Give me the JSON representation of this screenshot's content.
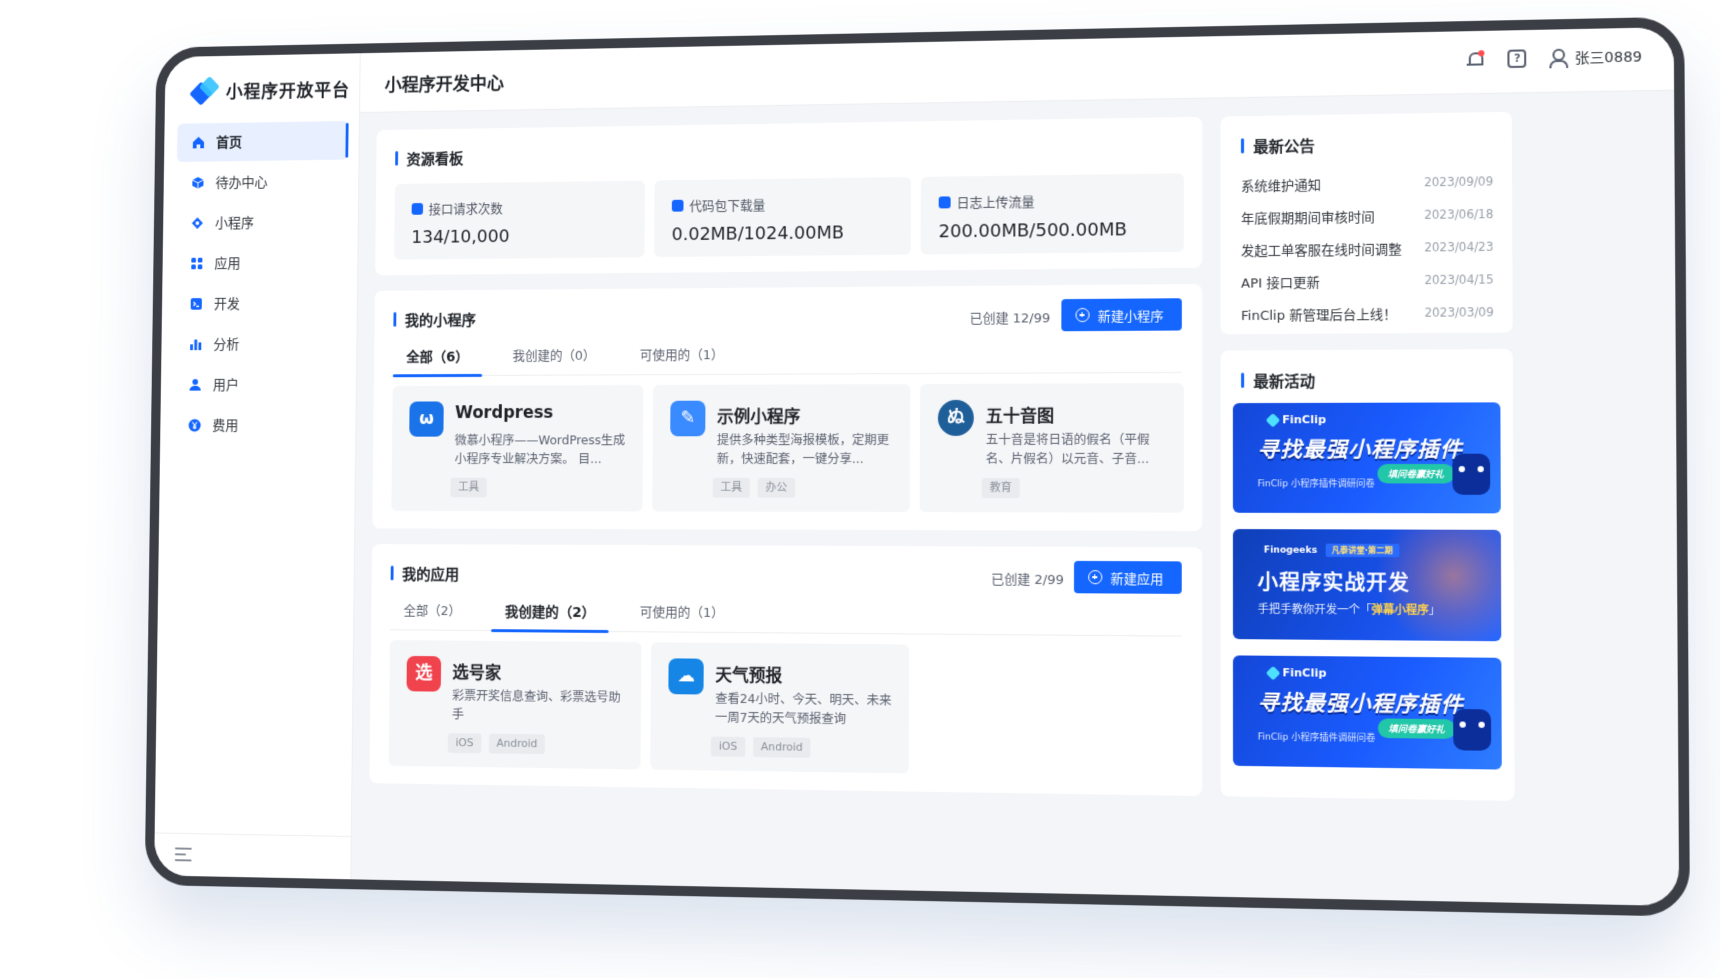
{
  "sidebar": {
    "logo_text": "小程序开放平台",
    "items": [
      {
        "label": "首页",
        "icon": "home-icon"
      },
      {
        "label": "待办中心",
        "icon": "cube-icon"
      },
      {
        "label": "小程序",
        "icon": "diamond-icon"
      },
      {
        "label": "应用",
        "icon": "grid-icon"
      },
      {
        "label": "开发",
        "icon": "terminal-icon"
      },
      {
        "label": "分析",
        "icon": "bar-chart-icon"
      },
      {
        "label": "用户",
        "icon": "user-icon"
      },
      {
        "label": "费用",
        "icon": "yen-icon"
      }
    ],
    "active_index": 0
  },
  "header": {
    "title": "小程序开发中心",
    "username": "张三0889"
  },
  "resources": {
    "title": "资源看板",
    "stats": [
      {
        "label": "接口请求次数",
        "value": "134/10,000"
      },
      {
        "label": "代码包下载量",
        "value": "0.02MB/1024.00MB"
      },
      {
        "label": "日志上传流量",
        "value": "200.00MB/500.00MB"
      }
    ]
  },
  "mini_programs": {
    "title": "我的小程序",
    "created_text": "已创建 12/99",
    "new_button": "新建小程序",
    "tabs": [
      "全部（6）",
      "我创建的（0）",
      "可使用的（1）"
    ],
    "active_tab": 0,
    "cards": [
      {
        "name": "Wordpress",
        "desc": "微慕小程序——WordPress生成小程序专业解决方案。 目...",
        "tags": [
          "工具"
        ],
        "icon_text": "ω",
        "color": "#1a73e8"
      },
      {
        "name": "示例小程序",
        "desc": "提供多种类型海报模板，定期更新，快速配套，一键分享...",
        "tags": [
          "工具",
          "办公"
        ],
        "icon_text": "✎",
        "color": "#3a8bff"
      },
      {
        "name": "五十音图",
        "desc": "五十音是将日语的假名（平假名、片假名）以元音、子音...",
        "tags": [
          "教育"
        ],
        "icon_text": "ぬ",
        "color": "#1f5f99"
      }
    ]
  },
  "apps": {
    "title": "我的应用",
    "created_text": "已创建 2/99",
    "new_button": "新建应用",
    "tabs": [
      "全部（2）",
      "我创建的（2）",
      "可使用的（1）"
    ],
    "active_tab": 1,
    "cards": [
      {
        "name": "选号家",
        "desc": "彩票开奖信息查询、彩票选号助手",
        "tags": [
          "iOS",
          "Android"
        ],
        "icon_text": "选",
        "color": "#f0434e"
      },
      {
        "name": "天气预报",
        "desc": "查看24小时、今天、明天、未来一周7天的天气预报查询",
        "tags": [
          "iOS",
          "Android"
        ],
        "icon_text": "☁",
        "color": "#1686e6"
      }
    ]
  },
  "notices": {
    "title": "最新公告",
    "items": [
      {
        "text": "系统维护通知",
        "date": "2023/09/09"
      },
      {
        "text": "年底假期期间审核时间",
        "date": "2023/06/18"
      },
      {
        "text": "发起工单客服在线时间调整",
        "date": "2023/04/23"
      },
      {
        "text": "API 接口更新",
        "date": "2023/04/15"
      },
      {
        "text": "FinClip 新管理后台上线！",
        "date": "2023/03/09"
      }
    ]
  },
  "activities": {
    "title": "最新活动",
    "banners": [
      {
        "brand": "FinClip",
        "headline": "寻找最强小程序插件",
        "sub": "FinClip 小程序插件调研问卷",
        "pill": "填问卷赢好礼"
      },
      {
        "brand": "Finogeeks",
        "tag": "凡泰讲堂·第二期",
        "headline": "小程序实战开发",
        "sub_before": "手把手教你开发一个「",
        "sub_highlight": "弹幕小程序",
        "sub_after": "」"
      },
      {
        "brand": "FinClip",
        "headline": "寻找最强小程序插件",
        "sub": "FinClip 小程序插件调研问卷",
        "pill": "填问卷赢好礼"
      }
    ]
  }
}
